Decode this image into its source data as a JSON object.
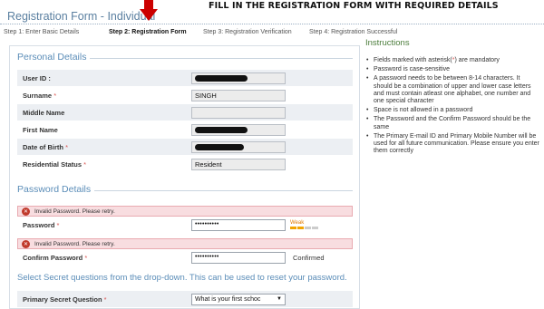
{
  "banner": {
    "overlay_title": "FILL IN THE REGISTRATION FORM WITH REQUIRED DETAILS",
    "form_title": "Registration Form - Individual",
    "arrow_color": "#cc0000"
  },
  "steps": [
    {
      "label": "Step 1: Enter Basic Details",
      "active": false
    },
    {
      "label": "Step 2: Registration Form",
      "active": true
    },
    {
      "label": "Step 3: Registration Verification",
      "active": false
    },
    {
      "label": "Step 4: Registration Successful",
      "active": false
    }
  ],
  "personal": {
    "section_label": "Personal Details",
    "user_id": {
      "label": "User ID :",
      "redacted": true
    },
    "surname": {
      "label": "Surname",
      "value": "SINGH"
    },
    "middle_name": {
      "label": "Middle Name",
      "value": ""
    },
    "first_name": {
      "label": "First Name",
      "redacted": true
    },
    "dob": {
      "label": "Date of Birth",
      "redacted": true
    },
    "residential_status": {
      "label": "Residential Status",
      "value": "Resident"
    },
    "required_marker": "*"
  },
  "password": {
    "section_label": "Password Details",
    "error1": "Invalid Password. Please retry.",
    "password_label": "Password",
    "password_value": "••••••••••",
    "strength_label": "Weak",
    "strength_level": 0.5,
    "error2": "Invalid Password. Please retry.",
    "confirm_label": "Confirm Password",
    "confirm_value": "••••••••••",
    "confirm_status": "Confirmed"
  },
  "secret": {
    "note": "Select Secret questions from the drop-down. This can be used to reset your password.",
    "primary_label": "Primary Secret Question",
    "primary_value": "What is your first schoc"
  },
  "instructions": {
    "title": "Instructions",
    "items": [
      {
        "pre": "Fields marked with asterisk(",
        "ast": "*",
        "post": ") are mandatory"
      },
      {
        "pre": "Password is case-sensitive",
        "ast": "",
        "post": ""
      },
      {
        "pre": "A password needs to be between 8-14 characters. It should be a combination of upper and lower case letters and must contain atleast one alphabet, one number and one special character",
        "ast": "",
        "post": ""
      },
      {
        "pre": "Space is not allowed in a password",
        "ast": "",
        "post": ""
      },
      {
        "pre": "The Password and the Confirm Password should be the same",
        "ast": "",
        "post": ""
      },
      {
        "pre": "The Primary E-mail ID and Primary Mobile Number will be used for all future communication. Please ensure you enter them correctly",
        "ast": "",
        "post": ""
      }
    ]
  },
  "colors": {
    "accent_blue": "#5b8db8",
    "required_red": "#d9534f",
    "error_bg": "#f8dde0",
    "instructions_green": "#4a7c3a"
  },
  "icons": {
    "error": "error-circle-icon",
    "arrow": "down-arrow-icon",
    "dropdown": "chevron-down-icon"
  }
}
